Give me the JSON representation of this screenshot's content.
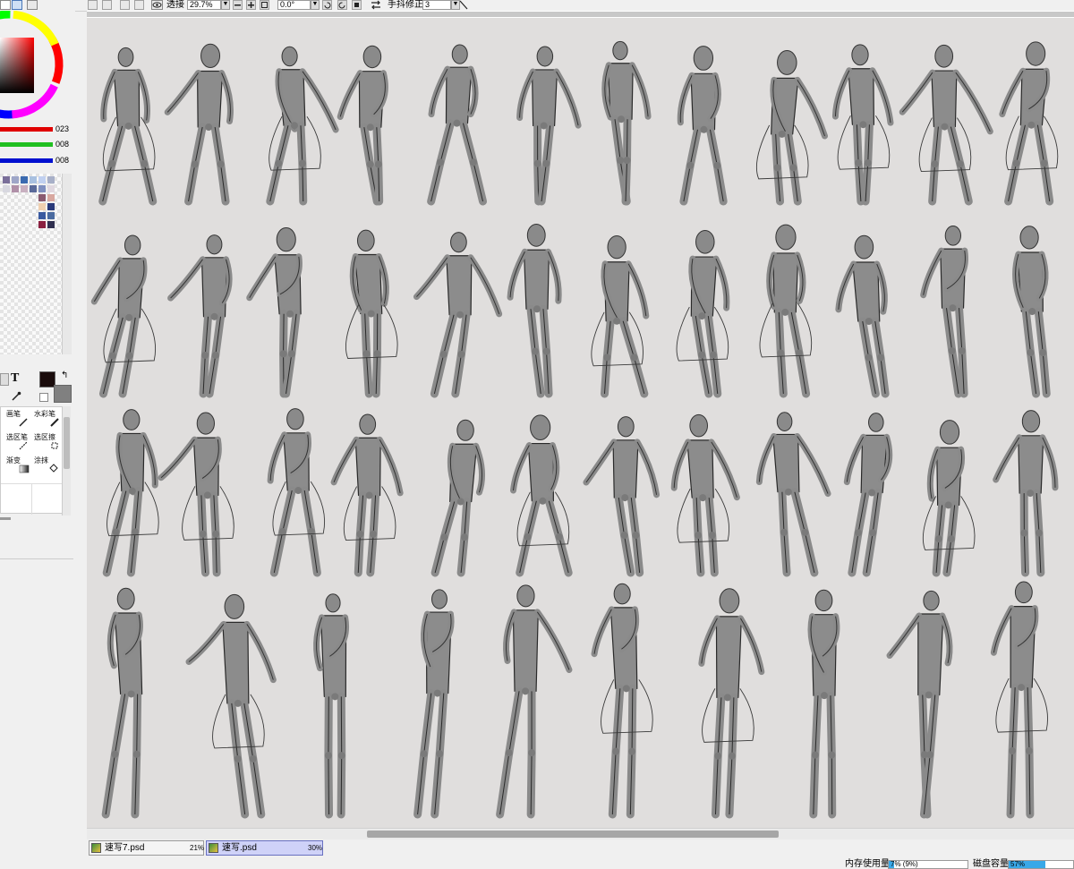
{
  "toolbar": {
    "view_label": "透接",
    "zoom_value": "29.7%",
    "rotation_value": "0.0°",
    "stabilizer_label": "手抖修正",
    "stabilizer_value": "3"
  },
  "color_panel": {
    "sliders": [
      {
        "name": "red",
        "value": "023",
        "color": "#e00000"
      },
      {
        "name": "green",
        "value": "008",
        "color": "#20c020"
      },
      {
        "name": "blue",
        "value": "008",
        "color": "#0010d0"
      }
    ],
    "primary_color": "#1a0c0c",
    "secondary_color": "#808080",
    "swatches": [
      "#7a6f9a",
      "#9ea6c8",
      "#3a6ab0",
      "#a8c0e0",
      "#c0d0f0",
      "#a8b0c8",
      "#d8d8e0",
      "#b090a8",
      "#c8b0c0",
      "#5a6a9a",
      "#8090c0",
      "#e0d8e0",
      "#8a5a70",
      "#d8a8a0",
      "#f0d0b0",
      "#2a3a7a",
      "#3a5aa0",
      "#4a6aa0",
      "#8a2040",
      "#303050"
    ]
  },
  "tools": {
    "text_tool_label": "T",
    "brush_label": "画笔",
    "watercolor_label": "水彩笔",
    "select_pen_label": "选区笔",
    "select_eraser_label": "选区擦",
    "gradient_label": "渐变",
    "bucket_label": "涂抹"
  },
  "documents": [
    {
      "name": "速写7.psd",
      "zoom": "21%",
      "active": false
    },
    {
      "name": "速写.psd",
      "zoom": "30%",
      "active": true
    }
  ],
  "status": {
    "memory_label": "内存使用量",
    "memory_value": "7% (9%)",
    "memory_fraction": 0.07,
    "disk_label": "磁盘容量",
    "disk_value": "57%",
    "disk_fraction": 0.57,
    "meter_color": "#39a8e8"
  }
}
